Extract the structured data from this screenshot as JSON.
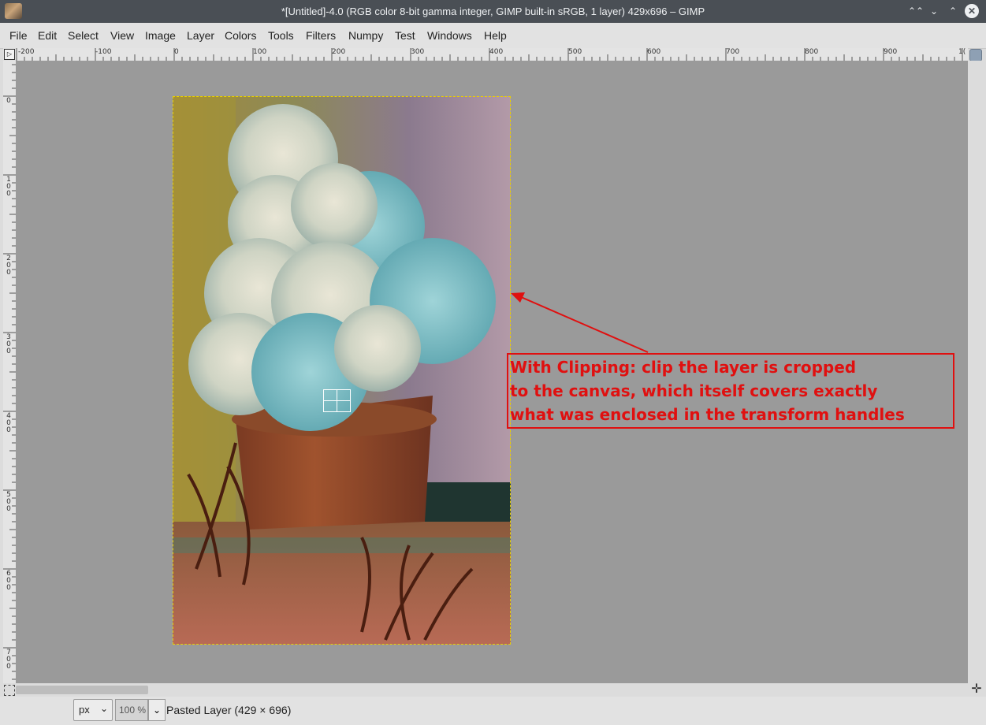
{
  "window": {
    "title": "*[Untitled]-4.0 (RGB color 8-bit gamma integer, GIMP built-in sRGB, 1 layer) 429x696 – GIMP"
  },
  "menu": {
    "items": [
      "File",
      "Edit",
      "Select",
      "View",
      "Image",
      "Layer",
      "Colors",
      "Tools",
      "Filters",
      "Numpy",
      "Test",
      "Windows",
      "Help"
    ]
  },
  "rulers": {
    "horizontal_labels": [
      "-200",
      "-100",
      "0",
      "100",
      "200",
      "300",
      "400",
      "500",
      "600",
      "700",
      "800",
      "900",
      "1("
    ],
    "vertical_labels": [
      [
        "0"
      ],
      [
        "1",
        "0",
        "0"
      ],
      [
        "2",
        "0",
        "0"
      ],
      [
        "3",
        "0",
        "0"
      ],
      [
        "4",
        "0",
        "0"
      ],
      [
        "5",
        "0",
        "0"
      ],
      [
        "6",
        "0",
        "0"
      ],
      [
        "7",
        "0",
        "0"
      ]
    ]
  },
  "annotation": {
    "lines": [
      "With Clipping: clip the layer is cropped",
      "to the canvas, which itself covers exactly",
      "what was enclosed in the transform handles"
    ],
    "color": "#e01010"
  },
  "statusbar": {
    "unit": "px",
    "zoom": "100 %",
    "layer_info": "Pasted Layer (429 × 696)"
  },
  "colors": {
    "canvas_bg": "#9a9a9a",
    "titlebar": "#4a4f55",
    "boundary": "#e8d000"
  }
}
